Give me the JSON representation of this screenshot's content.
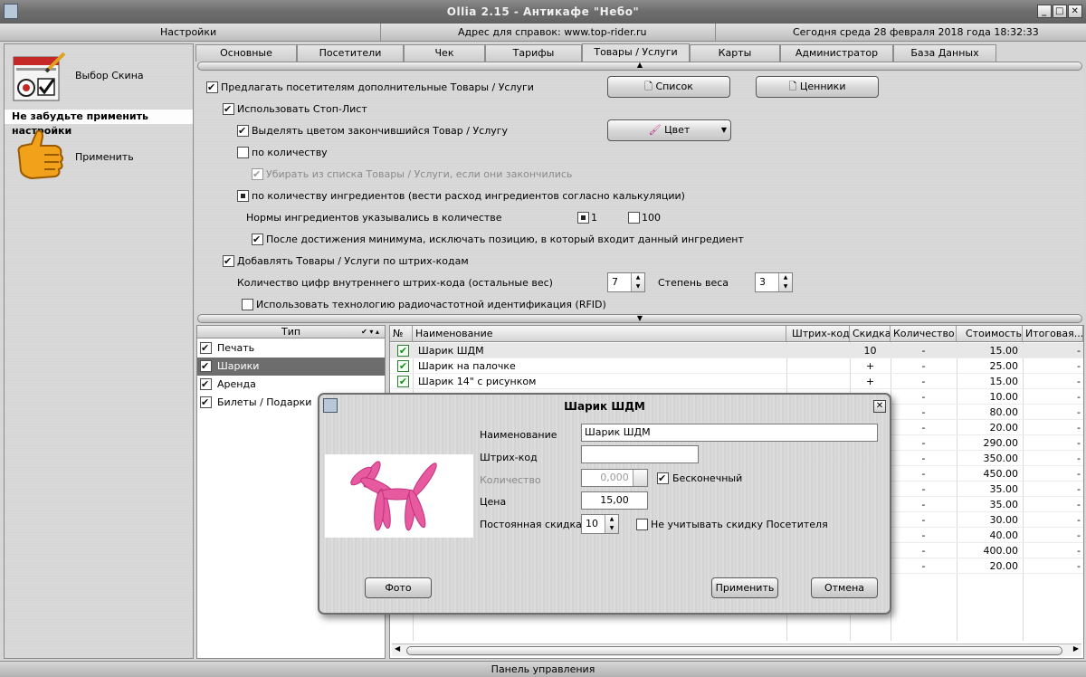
{
  "window": {
    "title": "Ollia 2.15 - Антикафе \"Небо\"",
    "controls": [
      "_",
      "□",
      "✕"
    ]
  },
  "infobar": {
    "left": "Настройки",
    "center": "Адрес для справок: www.top-rider.ru",
    "right": "Сегодня  среда  28 февраля 2018 года  18:32:33"
  },
  "sidebar": {
    "skin_label": "Выбор Скина",
    "reminder": "Не забудьте применить настройки",
    "apply_label": "Применить"
  },
  "tabs": [
    "Основные",
    "Посетители",
    "Чек",
    "Тарифы",
    "Товары / Услуги",
    "Карты",
    "Администратор",
    "База Данных"
  ],
  "active_tab": "Товары / Услуги",
  "settings": {
    "offer_goods": {
      "label": "Предлагать посетителям дополнительные Товары / Услуги",
      "checked": true
    },
    "list_button": "Список",
    "price_tags_button": "Ценники",
    "use_stop_list": {
      "label": "Использовать Стоп-Лист",
      "checked": true
    },
    "highlight_finished": {
      "label": "Выделять цветом закончившийся Товар / Услугу",
      "checked": true
    },
    "color_button": "Цвет",
    "by_quantity": {
      "label": "по количеству",
      "checked": false
    },
    "remove_finished": {
      "label": "Убирать из списка Товары / Услуги, если они закончились",
      "checked": true,
      "disabled": true
    },
    "by_ingredients": {
      "label": "по количеству ингредиентов (вести расход ингредиентов согласно калькуляции)",
      "checked": true
    },
    "norms_label": "Нормы ингредиентов указывались в количестве",
    "norm_1": "1",
    "norm_100": "100",
    "exclude_position": {
      "label": "После достижения минимума, исключать позицию, в который входит данный ингредиент",
      "checked": true
    },
    "add_by_barcode": {
      "label": "Добавлять Товары / Услуги по штрих-кодам",
      "checked": true
    },
    "barcode_digits_label": "Количество цифр внутреннего штрих-кода (остальные вес)",
    "barcode_digits": "7",
    "weight_degree_label": "Степень веса",
    "weight_degree": "3",
    "rfid": {
      "label": "Использовать технологию радиочастотной идентификация (RFID)",
      "checked": false
    }
  },
  "types": {
    "header": "Тип",
    "header_icons": "✔ ▾ ▴",
    "items": [
      {
        "label": "Печать",
        "checked": true
      },
      {
        "label": "Шарики",
        "checked": true
      },
      {
        "label": "Аренда",
        "checked": true
      },
      {
        "label": "Билеты / Подарки",
        "checked": true
      }
    ],
    "selected": "Шарики"
  },
  "grid": {
    "columns": [
      "№",
      "Наименование",
      "Штрих-код",
      "Скидка",
      "Количество",
      "Стоимость",
      "Итоговая..."
    ],
    "rows": [
      {
        "name": "Шарик ШДМ",
        "discount": "10",
        "qty": "-",
        "cost": "15.00",
        "total": "-"
      },
      {
        "name": "Шарик на палочке",
        "discount": "+",
        "qty": "-",
        "cost": "25.00",
        "total": "-"
      },
      {
        "name": "Шарик 14\" с рисунком",
        "discount": "+",
        "qty": "-",
        "cost": "15.00",
        "total": "-"
      },
      {
        "name": "",
        "discount": "+",
        "qty": "-",
        "cost": "10.00",
        "total": "-"
      },
      {
        "name": "",
        "discount": "",
        "qty": "-",
        "cost": "80.00",
        "total": "-"
      },
      {
        "name": "",
        "discount": "",
        "qty": "-",
        "cost": "20.00",
        "total": "-"
      },
      {
        "name": "",
        "discount": "",
        "qty": "-",
        "cost": "290.00",
        "total": "-"
      },
      {
        "name": "",
        "discount": "",
        "qty": "-",
        "cost": "350.00",
        "total": "-"
      },
      {
        "name": "",
        "discount": "",
        "qty": "-",
        "cost": "450.00",
        "total": "-"
      },
      {
        "name": "",
        "discount": "",
        "qty": "-",
        "cost": "35.00",
        "total": "-"
      },
      {
        "name": "",
        "discount": "",
        "qty": "-",
        "cost": "35.00",
        "total": "-"
      },
      {
        "name": "",
        "discount": "",
        "qty": "-",
        "cost": "30.00",
        "total": "-"
      },
      {
        "name": "",
        "discount": "",
        "qty": "-",
        "cost": "40.00",
        "total": "-"
      },
      {
        "name": "",
        "discount": "",
        "qty": "-",
        "cost": "400.00",
        "total": "-"
      },
      {
        "name": "",
        "discount": "",
        "qty": "-",
        "cost": "20.00",
        "total": "-"
      }
    ]
  },
  "statusbar": "Панель управления",
  "dialog": {
    "title": "Шарик ШДМ",
    "name_label": "Наименование",
    "name_value": "Шарик ШДМ",
    "barcode_label": "Штрих-код",
    "barcode_value": "",
    "quantity_label": "Количество",
    "quantity_value": "0,000",
    "infinite_label": "Бесконечный",
    "infinite_checked": true,
    "price_label": "Цена",
    "price_value": "15,00",
    "discount_label": "Постоянная скидка",
    "discount_value": "10",
    "ignore_discount_label": "Не учитывать скидку Посетителя",
    "ignore_discount_checked": false,
    "photo_button": "Фото",
    "apply_button": "Применить",
    "cancel_button": "Отмена"
  },
  "colors": {
    "selected_row": "#6d6d6d",
    "balloon": "#e85aa0",
    "grid_check": "#1b8a1b"
  }
}
